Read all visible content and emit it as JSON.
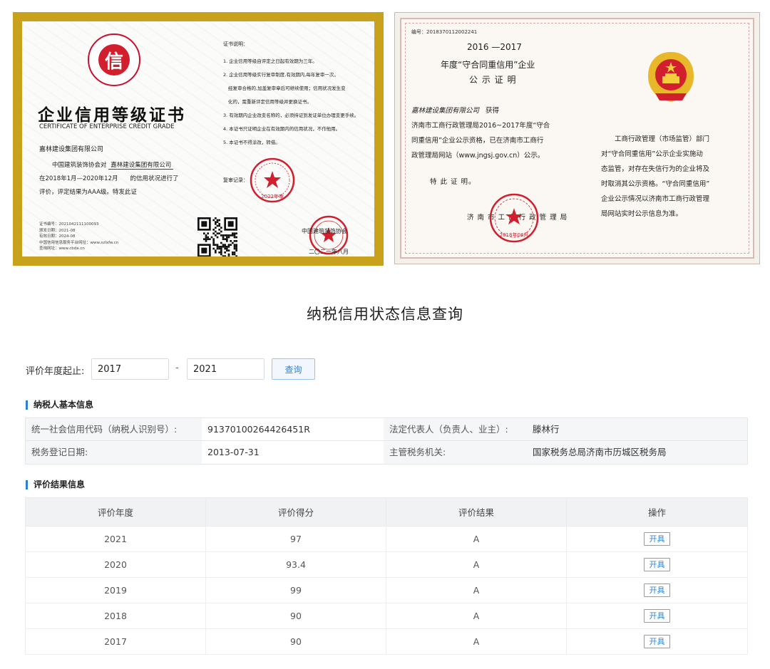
{
  "cert1": {
    "logo_glyph": "信",
    "title": "企业信用等级证书",
    "subtitle": "CERTIFICATE OF ENTERPRISE CREDIT GRADE",
    "company": "嘉林建设集团有限公司",
    "line1_prefix": "中国建筑装饰协会对",
    "line1_company": "嘉林建设集团有限公司",
    "line2": "在2018年1月—2020年12月　　的信用状况进行了",
    "line3": "评价，评定结果为AAA级。特发此证",
    "meta": [
      "证书编号：2021042111100093",
      "颁发日期：2021-08",
      "有效日期：2024-08",
      "中国信用信息服务平台网址：www.xzlxfw.cn",
      "查询网址：www.cbda.cn"
    ],
    "notes_heading": "证书说明：",
    "notes": [
      "1. 企业信用等级自评定之日起有效期为三年。",
      "2. 企业信用等级实行复审制度,有效期内,每年复审一次。",
      "经复审合格的,加盖复审章后可继续使用；信用状况发生变",
      "化的，需重新评定信用等级并更换证书。",
      "3. 有效期内企业改变名称的，必须持证到发证单位办理变更手续。",
      "4. 本证书只证明企业在有效期内的信用状况，不作他用。",
      "5. 本证书不得涂改，转借。"
    ],
    "review_label": "复审记录：",
    "review_stamp_text": "2022年审",
    "issuer": "中国建筑装饰协会",
    "date": "二〇二一年八月"
  },
  "cert2": {
    "serial": "编号：2018370112002241",
    "year_range": "2016 —2017",
    "title_line1": "年度“守合同重信用”企业",
    "title_line2": "公 示 证 明",
    "body_company": "嘉林建设集团有限公司",
    "body_left": [
      "获得",
      "济南市工商行政管理局2016~2017年度“守合",
      "同重信用”企业公示资格，已在济南市工商行",
      "政管理局网站（www.jngsj.gov.cn）公示。"
    ],
    "special_note": "特 此 证 明。",
    "authority": "济 南 市 工 商 行 政 管 理 局",
    "stamp_date": "2018年08月",
    "body_right": [
      "　　工商行政管理（市场监管）部门",
      "对“守合同重信用”公示企业实施动",
      "态监管，对存在失信行为的企业将及",
      "时取消其公示资格。“守合同重信用”",
      "企业公示情况以济南市工商行政管理",
      "局网站实时公示信息为准。"
    ]
  },
  "query": {
    "title": "纳税信用状态信息查询",
    "filter_label": "评价年度起止:",
    "year_from": "2017",
    "dash": "-",
    "year_to": "2021",
    "search_label": "查询"
  },
  "basic": {
    "heading": "纳税人基本信息",
    "credit_code_label": "统一社会信用代码（纳税人识别号）:",
    "credit_code": "91370100264426451R",
    "legal_rep_label": "法定代表人（负责人、业主）:",
    "legal_rep": "滕林行",
    "reg_date_label": "税务登记日期:",
    "reg_date": "2013-07-31",
    "authority_label": "主管税务机关:",
    "authority": "国家税务总局济南市历城区税务局"
  },
  "evaluation": {
    "heading": "评价结果信息",
    "columns": [
      "评价年度",
      "评价得分",
      "评价结果",
      "操作"
    ],
    "rows": [
      {
        "year": "2021",
        "score": "97",
        "result": "A",
        "action": "开具"
      },
      {
        "year": "2020",
        "score": "93.4",
        "result": "A",
        "action": "开具"
      },
      {
        "year": "2019",
        "score": "99",
        "result": "A",
        "action": "开具"
      },
      {
        "year": "2018",
        "score": "90",
        "result": "A",
        "action": "开具"
      },
      {
        "year": "2017",
        "score": "90",
        "result": "A",
        "action": "开具"
      }
    ]
  },
  "colors": {
    "accent": "#2d7fd1",
    "seal_red": "#d21f2d",
    "cert_gold": "#c8a21c"
  }
}
